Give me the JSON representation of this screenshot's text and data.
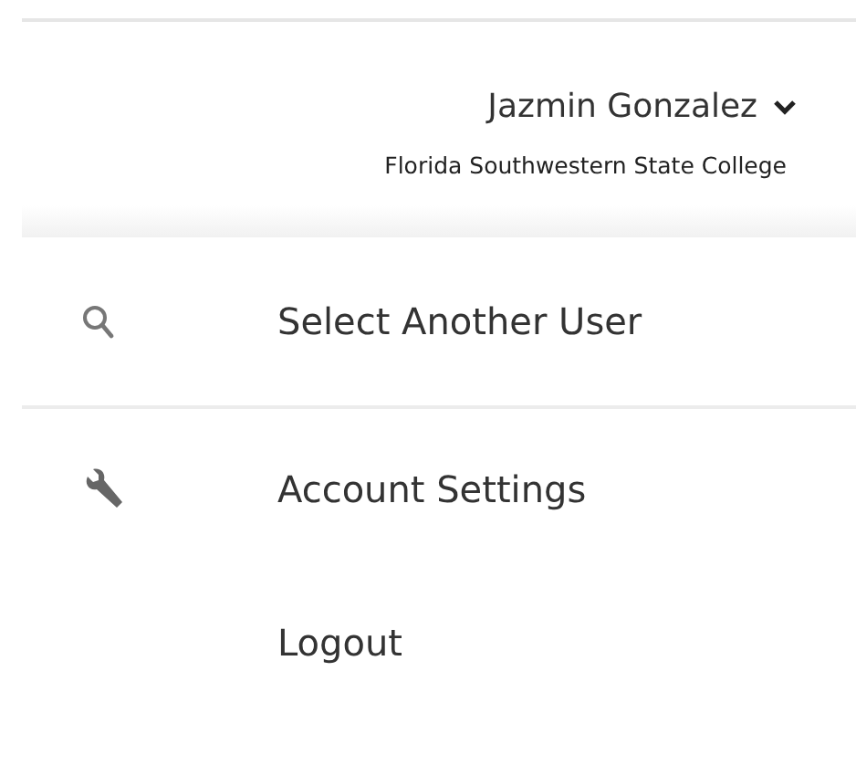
{
  "user": {
    "name": "Jazmin Gonzalez",
    "organization": "Florida Southwestern State College"
  },
  "menu": [
    {
      "label": "Select Another User",
      "kind": "search"
    },
    {
      "label": "Account Settings",
      "kind": "wrench"
    },
    {
      "label": "Logout",
      "kind": "plain"
    }
  ]
}
